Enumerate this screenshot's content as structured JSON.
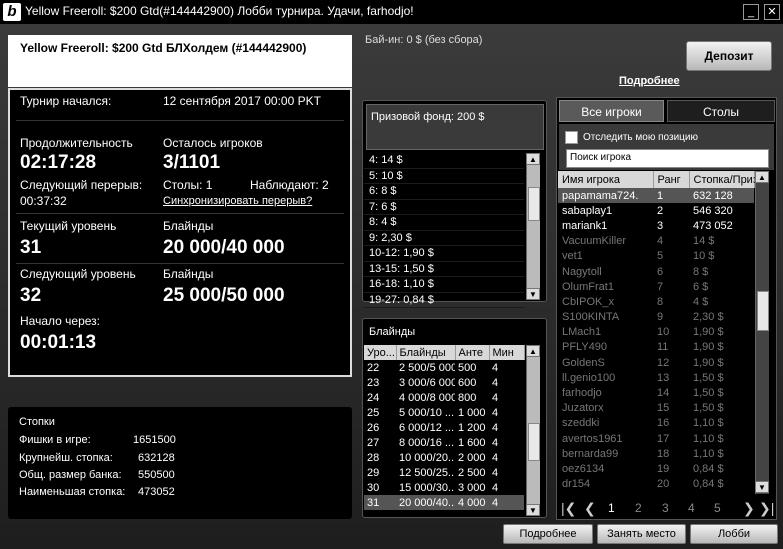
{
  "window": {
    "title": "Yellow Freeroll: $200 Gtd(#144442900) Лобби турнира. Удачи, farhodjo!",
    "logo": "b",
    "minimize": "_",
    "close": "✕"
  },
  "header": {
    "name": "Yellow Freeroll: $200 Gtd БЛХолдем (#144442900)"
  },
  "info": {
    "started_label": "Турнир начался:",
    "started_value": "12 сентября 2017  00:00 PKT",
    "duration_label": "Продолжительность",
    "duration_value": "02:17:28",
    "remaining_label": "Осталось игроков",
    "remaining_value": "3/1101",
    "next_break_label": "Следующий перерыв:",
    "next_break_value": "00:37:32",
    "tables": "Столы: 1",
    "watching": "Наблюдают: 2",
    "sync_link": "Синхронизировать перерыв?",
    "current_level_label": "Текущий уровень",
    "current_level_value": "31",
    "blinds_label": "Блайнды",
    "current_blinds": "20 000/40 000",
    "next_level_label": "Следующий уровень",
    "next_level_value": "32",
    "next_blinds_label": "Блайнды",
    "next_blinds": "25 000/50 000",
    "starts_in_label": "Начало через:",
    "starts_in_value": "00:01:13"
  },
  "stacks": {
    "title": "Стопки",
    "rows": [
      {
        "label": "Фишки в игре:",
        "value": "1651500"
      },
      {
        "label": "Крупнейш. стопка:",
        "value": "632128"
      },
      {
        "label": "Общ. размер банка:",
        "value": "550500"
      },
      {
        "label": "Наименьшая стопка:",
        "value": "473052"
      }
    ]
  },
  "buyin": "Бай-ин: 0 $ (без сбора)",
  "prize": {
    "header": "Призовой фонд: 200 $",
    "rows": [
      "4: 14 $",
      "5: 10 $",
      "6: 8 $",
      "7: 6 $",
      "8: 4 $",
      "9: 2,30 $",
      "10-12: 1,90 $",
      "13-15: 1,50 $",
      "16-18: 1,10 $",
      "19-27: 0,84 $"
    ]
  },
  "blinds": {
    "title": "Блайнды",
    "columns": [
      "Уро...",
      "Блайнды",
      "Анте",
      "Мин"
    ],
    "rows": [
      [
        "22",
        "2 500/5 000",
        "500",
        "4"
      ],
      [
        "23",
        "3 000/6 000",
        "600",
        "4"
      ],
      [
        "24",
        "4 000/8 000",
        "800",
        "4"
      ],
      [
        "25",
        "5 000/10 ...",
        "1 000",
        "4"
      ],
      [
        "26",
        "6 000/12 ...",
        "1 200",
        "4"
      ],
      [
        "27",
        "8 000/16 ...",
        "1 600",
        "4"
      ],
      [
        "28",
        "10 000/20...",
        "2 000",
        "4"
      ],
      [
        "29",
        "12 500/25...",
        "2 500",
        "4"
      ],
      [
        "30",
        "15 000/30...",
        "3 000",
        "4"
      ],
      [
        "31",
        "20 000/40...",
        "4 000",
        "4"
      ]
    ]
  },
  "deposit": "Депозит",
  "more_link": "Подробнее",
  "tabs": {
    "all_players": "Все игроки",
    "tables": "Столы"
  },
  "track_label": "Отследить мою позицию",
  "search_placeholder": "Поиск игрока",
  "players": {
    "columns": [
      "Имя игрока",
      "Ранг",
      "Стопка/Приз"
    ],
    "rows": [
      [
        "papamama724.",
        "1",
        "632 128"
      ],
      [
        "sabaplay1",
        "2",
        "546 320"
      ],
      [
        "mariank1",
        "3",
        "473 052"
      ],
      [
        "VacuumKiller",
        "4",
        "14 $"
      ],
      [
        "vet1",
        "5",
        "10 $"
      ],
      [
        "Nagytoll",
        "6",
        "8 $"
      ],
      [
        "OlumFrat1",
        "7",
        "6 $"
      ],
      [
        "CbIPOK_x",
        "8",
        "4 $"
      ],
      [
        "S100KINTA",
        "9",
        "2,30 $"
      ],
      [
        "LMach1",
        "10",
        "1,90 $"
      ],
      [
        "PFLY490",
        "11",
        "1,90 $"
      ],
      [
        "GoldenS",
        "12",
        "1,90 $"
      ],
      [
        "ll.genio100",
        "13",
        "1,50 $"
      ],
      [
        "farhodjo",
        "14",
        "1,50 $"
      ],
      [
        "Juzatorx",
        "15",
        "1,50 $"
      ],
      [
        "szeddki",
        "16",
        "1,10 $"
      ],
      [
        "avertos1961",
        "17",
        "1,10 $"
      ],
      [
        "bernarda99",
        "18",
        "1,10 $"
      ],
      [
        "oez6134",
        "19",
        "0,84 $"
      ],
      [
        "dr154",
        "20",
        "0,84 $"
      ]
    ]
  },
  "pager": {
    "first": "|❮",
    "prev": "❮",
    "pages": [
      "1",
      "2",
      "3",
      "4",
      "5"
    ],
    "next": "❯",
    "last": "❯|"
  },
  "bottom": {
    "more": "Подробнее",
    "seat": "Занять место",
    "lobby": "Лобби"
  }
}
